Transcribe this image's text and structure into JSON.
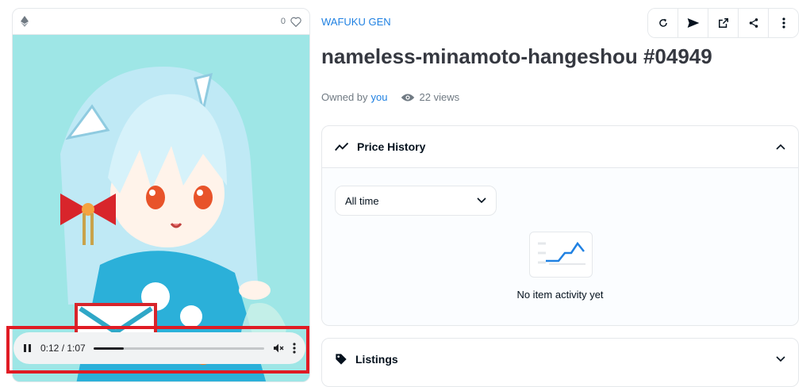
{
  "card": {
    "favorite_count": "0",
    "chain_icon": "ethereum-icon",
    "art_description_icon": "nft-artwork"
  },
  "player": {
    "time": "0:12 / 1:07",
    "progress": 0.18,
    "state": "playing"
  },
  "collection": {
    "name": "WAFUKU GEN"
  },
  "item": {
    "title": "nameless-minamoto-hangeshou #04949"
  },
  "meta": {
    "owned_by_label": "Owned by",
    "owner": "you",
    "views": "22 views"
  },
  "toolbar": {
    "icons": [
      "refresh-icon",
      "send-icon",
      "external-link-icon",
      "share-icon",
      "more-icon"
    ]
  },
  "price_history": {
    "title": "Price History",
    "range_select": "All time",
    "empty_text": "No item activity yet"
  },
  "listings": {
    "title": "Listings"
  },
  "colors": {
    "accent": "#2081e2",
    "highlight_border": "#e01b24",
    "art_background": "#9ee6e6"
  }
}
